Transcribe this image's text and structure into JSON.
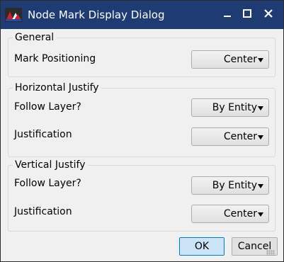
{
  "window": {
    "title": "Node Mark Display Dialog"
  },
  "groups": {
    "general": {
      "title": "General",
      "mark_positioning_label": "Mark Positioning",
      "mark_positioning_value": "Center"
    },
    "horizontal": {
      "title": "Horizontal Justify",
      "follow_layer_label": "Follow Layer?",
      "follow_layer_value": "By Entity",
      "justification_label": "Justification",
      "justification_value": "Center"
    },
    "vertical": {
      "title": "Vertical Justify",
      "follow_layer_label": "Follow Layer?",
      "follow_layer_value": "By Entity",
      "justification_label": "Justification",
      "justification_value": "Center"
    }
  },
  "buttons": {
    "ok": "OK",
    "cancel": "Cancel"
  },
  "icons": {
    "app": "app-logo-icon",
    "minimize": "minimize-icon",
    "maximize": "maximize-icon",
    "close": "close-icon",
    "dropdown": "chevron-down-icon"
  },
  "colors": {
    "titlebar": "#1f3b73",
    "ok_button": "#cce4f7",
    "ok_border": "#0078d7"
  }
}
